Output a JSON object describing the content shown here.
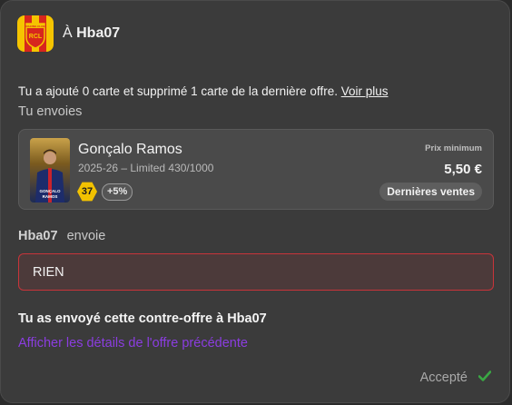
{
  "header": {
    "prefix": "À",
    "recipient": "Hba07",
    "logo_text": "RACING CLUB",
    "logo_initials": "RCL"
  },
  "info": {
    "text": "Tu a ajouté 0 carte et supprimé 1 carte de la dernière offre.",
    "link": "Voir plus"
  },
  "you_send_label": "Tu envoies",
  "card": {
    "player_name": "Gonçalo Ramos",
    "meta": "2025-26 – Limited 430/1000",
    "rating": "37",
    "bonus": "+5%",
    "card_name_line1": "GONÇALO",
    "card_name_line2": "RAMOS",
    "prix_label": "Prix minimum",
    "prix_value": "5,50 €",
    "last_sales_label": "Dernières ventes"
  },
  "sender": {
    "name": "Hba07",
    "verb": "envoie"
  },
  "nothing_value": "RIEN",
  "counter_title": "Tu as envoyé cette contre-offre à Hba07",
  "prev_offer_link": "Afficher les détails de l'offre précédente",
  "status": {
    "label": "Accepté",
    "icon": "check-icon"
  },
  "colors": {
    "accent_purple": "#8b3de0",
    "error_border": "#c8343a",
    "check_green": "#3aa844",
    "rating_gold": "#f2c200"
  }
}
